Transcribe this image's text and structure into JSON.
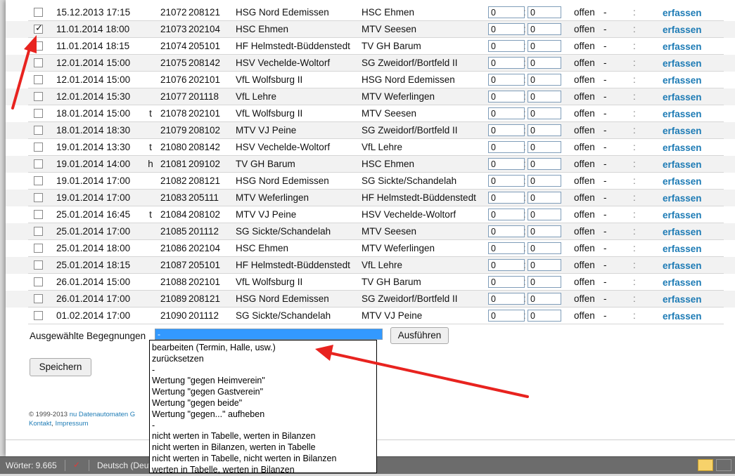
{
  "table": {
    "rows": [
      {
        "checked": false,
        "date": "15.12.2013 17:15",
        "flag": "",
        "nr": "21072",
        "code": "208121",
        "home": "HSG Nord Edemissen",
        "guest": "HSC Ehmen",
        "g1": "0",
        "g2": "0",
        "status": "offen",
        "dash": "-",
        "colon": ":",
        "link": "erfassen"
      },
      {
        "checked": true,
        "date": "11.01.2014 18:00",
        "flag": "",
        "nr": "21073",
        "code": "202104",
        "home": "HSC Ehmen",
        "guest": "MTV Seesen",
        "g1": "0",
        "g2": "0",
        "status": "offen",
        "dash": "-",
        "colon": ":",
        "link": "erfassen"
      },
      {
        "checked": false,
        "date": "11.01.2014 18:15",
        "flag": "",
        "nr": "21074",
        "code": "205101",
        "home": "HF Helmstedt-Büddenstedt",
        "guest": "TV GH Barum",
        "g1": "0",
        "g2": "0",
        "status": "offen",
        "dash": "-",
        "colon": ":",
        "link": "erfassen"
      },
      {
        "checked": false,
        "date": "12.01.2014 15:00",
        "flag": "",
        "nr": "21075",
        "code": "208142",
        "home": "HSV Vechelde-Woltorf",
        "guest": "SG Zweidorf/Bortfeld II",
        "g1": "0",
        "g2": "0",
        "status": "offen",
        "dash": "-",
        "colon": ":",
        "link": "erfassen"
      },
      {
        "checked": false,
        "date": "12.01.2014 15:00",
        "flag": "",
        "nr": "21076",
        "code": "202101",
        "home": "VfL Wolfsburg II",
        "guest": "HSG Nord Edemissen",
        "g1": "0",
        "g2": "0",
        "status": "offen",
        "dash": "-",
        "colon": ":",
        "link": "erfassen"
      },
      {
        "checked": false,
        "date": "12.01.2014 15:30",
        "flag": "",
        "nr": "21077",
        "code": "201118",
        "home": "VfL Lehre",
        "guest": "MTV Weferlingen",
        "g1": "0",
        "g2": "0",
        "status": "offen",
        "dash": "-",
        "colon": ":",
        "link": "erfassen"
      },
      {
        "checked": false,
        "date": "18.01.2014 15:00",
        "flag": "t",
        "nr": "21078",
        "code": "202101",
        "home": "VfL Wolfsburg II",
        "guest": "MTV Seesen",
        "g1": "0",
        "g2": "0",
        "status": "offen",
        "dash": "-",
        "colon": ":",
        "link": "erfassen"
      },
      {
        "checked": false,
        "date": "18.01.2014 18:30",
        "flag": "",
        "nr": "21079",
        "code": "208102",
        "home": "MTV VJ Peine",
        "guest": "SG Zweidorf/Bortfeld II",
        "g1": "0",
        "g2": "0",
        "status": "offen",
        "dash": "-",
        "colon": ":",
        "link": "erfassen"
      },
      {
        "checked": false,
        "date": "19.01.2014 13:30",
        "flag": "t",
        "nr": "21080",
        "code": "208142",
        "home": "HSV Vechelde-Woltorf",
        "guest": "VfL Lehre",
        "g1": "0",
        "g2": "0",
        "status": "offen",
        "dash": "-",
        "colon": ":",
        "link": "erfassen"
      },
      {
        "checked": false,
        "date": "19.01.2014 14:00",
        "flag": "h",
        "nr": "21081",
        "code": "209102",
        "home": "TV GH Barum",
        "guest": "HSC Ehmen",
        "g1": "0",
        "g2": "0",
        "status": "offen",
        "dash": "-",
        "colon": ":",
        "link": "erfassen"
      },
      {
        "checked": false,
        "date": "19.01.2014 17:00",
        "flag": "",
        "nr": "21082",
        "code": "208121",
        "home": "HSG Nord Edemissen",
        "guest": "SG Sickte/Schandelah",
        "g1": "0",
        "g2": "0",
        "status": "offen",
        "dash": "-",
        "colon": ":",
        "link": "erfassen"
      },
      {
        "checked": false,
        "date": "19.01.2014 17:00",
        "flag": "",
        "nr": "21083",
        "code": "205111",
        "home": "MTV Weferlingen",
        "guest": "HF Helmstedt-Büddenstedt",
        "g1": "0",
        "g2": "0",
        "status": "offen",
        "dash": "-",
        "colon": ":",
        "link": "erfassen"
      },
      {
        "checked": false,
        "date": "25.01.2014 16:45",
        "flag": "t",
        "nr": "21084",
        "code": "208102",
        "home": "MTV VJ Peine",
        "guest": "HSV Vechelde-Woltorf",
        "g1": "0",
        "g2": "0",
        "status": "offen",
        "dash": "-",
        "colon": ":",
        "link": "erfassen"
      },
      {
        "checked": false,
        "date": "25.01.2014 17:00",
        "flag": "",
        "nr": "21085",
        "code": "201112",
        "home": "SG Sickte/Schandelah",
        "guest": "MTV Seesen",
        "g1": "0",
        "g2": "0",
        "status": "offen",
        "dash": "-",
        "colon": ":",
        "link": "erfassen"
      },
      {
        "checked": false,
        "date": "25.01.2014 18:00",
        "flag": "",
        "nr": "21086",
        "code": "202104",
        "home": "HSC Ehmen",
        "guest": "MTV Weferlingen",
        "g1": "0",
        "g2": "0",
        "status": "offen",
        "dash": "-",
        "colon": ":",
        "link": "erfassen"
      },
      {
        "checked": false,
        "date": "25.01.2014 18:15",
        "flag": "",
        "nr": "21087",
        "code": "205101",
        "home": "HF Helmstedt-Büddenstedt",
        "guest": "VfL Lehre",
        "g1": "0",
        "g2": "0",
        "status": "offen",
        "dash": "-",
        "colon": ":",
        "link": "erfassen"
      },
      {
        "checked": false,
        "date": "26.01.2014 15:00",
        "flag": "",
        "nr": "21088",
        "code": "202101",
        "home": "VfL Wolfsburg II",
        "guest": "TV GH Barum",
        "g1": "0",
        "g2": "0",
        "status": "offen",
        "dash": "-",
        "colon": ":",
        "link": "erfassen"
      },
      {
        "checked": false,
        "date": "26.01.2014 17:00",
        "flag": "",
        "nr": "21089",
        "code": "208121",
        "home": "HSG Nord Edemissen",
        "guest": "SG Zweidorf/Bortfeld II",
        "g1": "0",
        "g2": "0",
        "status": "offen",
        "dash": "-",
        "colon": ":",
        "link": "erfassen"
      },
      {
        "checked": false,
        "date": "01.02.2014 17:00",
        "flag": "",
        "nr": "21090",
        "code": "201112",
        "home": "SG Sickte/Schandelah",
        "guest": "MTV VJ Peine",
        "g1": "0",
        "g2": "0",
        "status": "offen",
        "dash": "-",
        "colon": ":",
        "link": "erfassen"
      }
    ]
  },
  "actions": {
    "label": "Ausgewählte Begegnungen",
    "selected": "-",
    "run_label": "Ausführen",
    "options": [
      "bearbeiten (Termin, Halle, usw.)",
      "zurücksetzen",
      "-",
      "Wertung \"gegen Heimverein\"",
      "Wertung \"gegen Gastverein\"",
      "Wertung \"gegen beide\"",
      "Wertung \"gegen...\" aufheben",
      "-",
      "nicht werten in Tabelle, werten in Bilanzen",
      "nicht werten in Bilanzen, werten in Tabelle",
      "nicht werten in Tabelle, nicht werten in Bilanzen",
      "werten in Tabelle, werten in Bilanzen"
    ]
  },
  "save_label": "Speichern",
  "footer": {
    "copyright": "© 1999-2013",
    "company": "nu Datenautomaten G",
    "contact": "Kontakt",
    "sep": ", ",
    "impressum": "Impressum"
  },
  "statusbar": {
    "words": "Wörter: 9.665",
    "language": "Deutsch (Deut"
  },
  "colors": {
    "link": "#1d7bb5",
    "annotation_arrow": "#e8231f",
    "select_highlight": "#3399ff"
  }
}
